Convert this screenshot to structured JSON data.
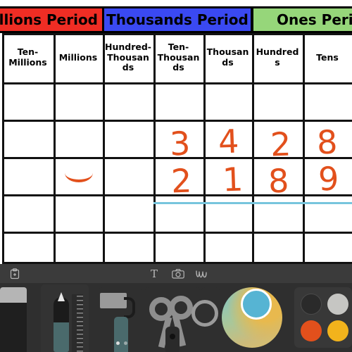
{
  "app": {
    "name": "whiteboard-drawing-app"
  },
  "board": {
    "periods": [
      {
        "id": "millions",
        "label": "Millions Period",
        "color": "#ef2d24",
        "clipped": "left"
      },
      {
        "id": "thousands",
        "label": "Thousands Period",
        "color": "#3a49f2",
        "clipped": "none"
      },
      {
        "id": "ones",
        "label": "Ones Period",
        "color": "#96d67a",
        "clipped": "right"
      }
    ],
    "columns": [
      {
        "id": "ten-millions",
        "label": "Ten-Millions"
      },
      {
        "id": "millions",
        "label": "Millions"
      },
      {
        "id": "hundred-thousands",
        "label": "Hundred-Thousands"
      },
      {
        "id": "ten-thousands",
        "label": "Ten-Thousands"
      },
      {
        "id": "thousands",
        "label": "Thousands"
      },
      {
        "id": "hundreds",
        "label": "Hundreds"
      },
      {
        "id": "tens",
        "label": "Tens"
      }
    ],
    "handwriting": {
      "ink_color": "#e2501c",
      "rule_color": "#77c5dd",
      "row_addend_1": {
        "ten-thousands": "3",
        "thousands": "4",
        "hundreds": "2",
        "tens": "8"
      },
      "row_addend_2": {
        "millions": "—",
        "ten-thousands": "2",
        "thousands": "1",
        "hundreds": "8",
        "tens": "9"
      },
      "rule_line": "underline beneath second addend row"
    }
  },
  "toolbar": {
    "icons": [
      {
        "id": "paste",
        "name": "paste-icon",
        "glyph": "⎘"
      },
      {
        "id": "text",
        "name": "text-tool-icon",
        "glyph": "T"
      },
      {
        "id": "camera",
        "name": "camera-icon",
        "glyph": "□"
      },
      {
        "id": "squiggle",
        "name": "squiggle-icon",
        "glyph": "∿"
      }
    ]
  },
  "palette": {
    "tools": [
      {
        "id": "eraser",
        "label": "Eraser"
      },
      {
        "id": "pen",
        "label": "Pen"
      },
      {
        "id": "roller",
        "label": "Paint Roller"
      },
      {
        "id": "scissors",
        "label": "Scissors"
      },
      {
        "id": "circle",
        "label": "Shape"
      }
    ],
    "color_wheel": {
      "selected_color": "#56b4d3",
      "label": "Color Wheel"
    },
    "swatches": [
      {
        "id": "black",
        "color": "#2a2a2a"
      },
      {
        "id": "white",
        "color": "#c6c6c3"
      },
      {
        "id": "orange",
        "color": "#e2501c"
      },
      {
        "id": "yellow",
        "color": "#f2b31c"
      },
      {
        "id": "green",
        "color": "#5c8040"
      }
    ]
  }
}
